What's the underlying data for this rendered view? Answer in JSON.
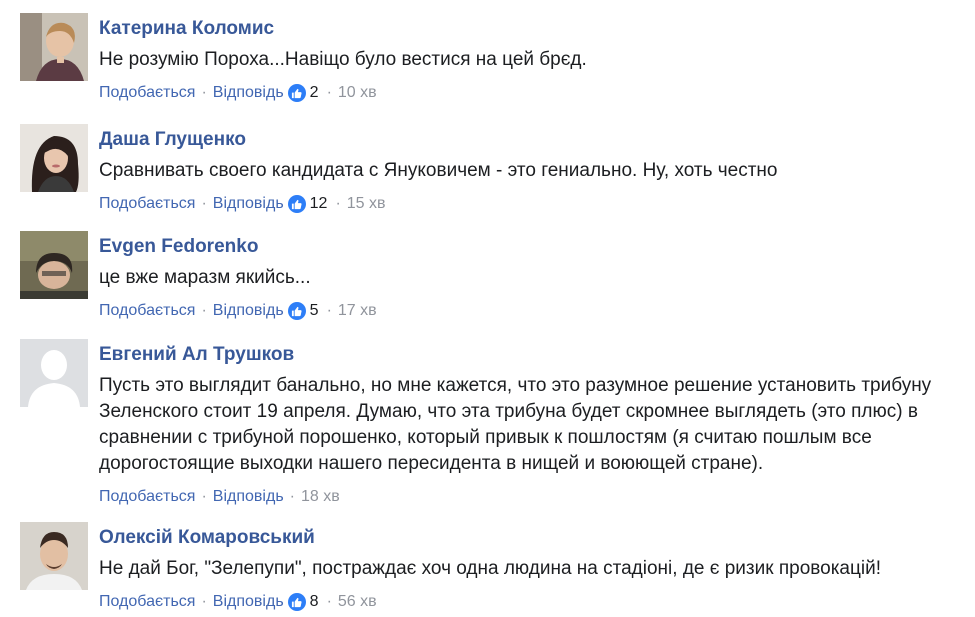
{
  "actions": {
    "like_label": "Подобається",
    "reply_label": "Відповідь",
    "separator": "·"
  },
  "comments": [
    {
      "author": "Катерина Коломис",
      "text": "Не розумію Пороха...Навіщо було вестися на цей брєд.",
      "likes": "2",
      "time": "10 хв",
      "avatar_icon": "portrait-photo"
    },
    {
      "author": "Даша Глущенко",
      "text": "Сравнивать своего кандидата с Януковичем - это гениально. Ну, хоть честно",
      "likes": "12",
      "time": "15 хв",
      "avatar_icon": "portrait-photo"
    },
    {
      "author": "Evgen Fedorenko",
      "text": "це вже маразм якийсь...",
      "likes": "5",
      "time": "17 хв",
      "avatar_icon": "portrait-photo"
    },
    {
      "author": "Евгений Ал Трушков",
      "text": "Пусть это выглядит банально, но мне кажется, что это разумное решение установить трибуну Зеленского стоит 19 апреля. Думаю, что эта трибуна будет скромнее выглядеть (это плюс) в сравнении с трибуной порошенко, который привык к пошлостям (я считаю пошлым все дорогостоящие выходки нашего пересидента в нищей и воюющей стране).",
      "time": "18 хв",
      "avatar_icon": "default-avatar-silhouette"
    },
    {
      "author": "Олексій Комаровський",
      "text": "Не дай Бог, \"Зелепупи\", постраждає хоч одна людина на стадіоні, де є ризик провокацій!",
      "likes": "8",
      "time": "56 хв",
      "avatar_icon": "portrait-photo"
    }
  ]
}
